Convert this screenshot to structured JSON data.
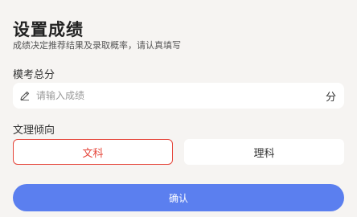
{
  "header": {
    "title": "设置成绩",
    "subtitle": "成绩决定推荐结果及录取概率，请认真填写"
  },
  "score": {
    "label": "模考总分",
    "placeholder": "请输入成绩",
    "value": "",
    "unit": "分",
    "icon": "pencil-icon"
  },
  "track": {
    "label": "文理倾向",
    "options": [
      {
        "label": "文科",
        "selected": true
      },
      {
        "label": "理科",
        "selected": false
      }
    ]
  },
  "confirm": {
    "label": "确认"
  },
  "colors": {
    "accent": "#5b7fef",
    "selected": "#e5453a",
    "background": "#f6f4f2"
  }
}
